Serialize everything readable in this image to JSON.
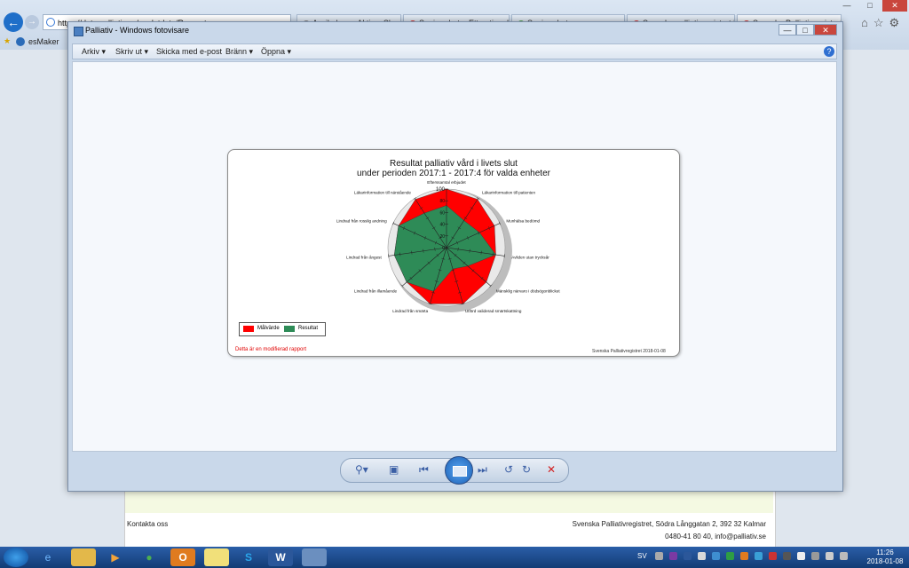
{
  "browser": {
    "address": "https://data.palliativ.se/applutdata/Rapport.aspx",
    "tabs": [
      "Avvikelser – Aktiv – Skumon",
      "Senior alert – Ett nationellt k",
      "Senior alert",
      "Svenska palliativregistret | E",
      "Svenska Palliativregistret"
    ],
    "bookmark": "esMaker"
  },
  "viewer": {
    "title": "Palliativ - Windows fotovisare",
    "menu": [
      "Arkiv",
      "Skriv ut",
      "Skicka med e-post",
      "Bränn",
      "Öppna"
    ],
    "help": "?"
  },
  "report": {
    "title_line1": "Resultat palliativ vård i livets slut",
    "title_line2": "under perioden 2017:1 - 2017:4 för valda enheter",
    "modified_note": "Detta är en modifierad rapport",
    "credit": "Svenska Palliativregistret 2018-01-08"
  },
  "chart_data": {
    "type": "radar",
    "title": "Resultat palliativ vård i livets slut under perioden 2017:1 - 2017:4 för valda enheter",
    "categories": [
      "Efterssamtal erbjudet",
      "Läkarinformation till patienten",
      "Munhälsa bedömd",
      "Avliden utan trycksår",
      "Mänsklig närvaro i dödsögonblicket",
      "Utförd validerad smärtskattning",
      "Lindrad från smärta",
      "Lindrad från illamående",
      "Lindrad från ångest",
      "Lindrad från rosslig andning",
      "Läkarinformation till närstående"
    ],
    "axis_ticks": [
      0,
      20,
      40,
      60,
      80,
      100
    ],
    "rmax": 100,
    "series": [
      {
        "name": "Målvärde",
        "color": "#ff0000",
        "values": [
          100,
          98,
          90,
          85,
          90,
          100,
          100,
          90,
          90,
          90,
          98
        ]
      },
      {
        "name": "Resultat",
        "color": "#2e8b57",
        "values": [
          72,
          55,
          62,
          85,
          48,
          38,
          78,
          90,
          90,
          90,
          70
        ]
      }
    ],
    "legend": "bottom-left"
  },
  "page": {
    "footer_left": "Kontakta oss",
    "footer_address": "Svenska Palliativregistret, Södra Långgatan 2, 392 32 Kalmar",
    "footer_contact": "0480-41 80 40,  info@palliativ.se"
  },
  "taskbar": {
    "lang": "SV",
    "time": "11:26",
    "date": "2018-01-08"
  }
}
